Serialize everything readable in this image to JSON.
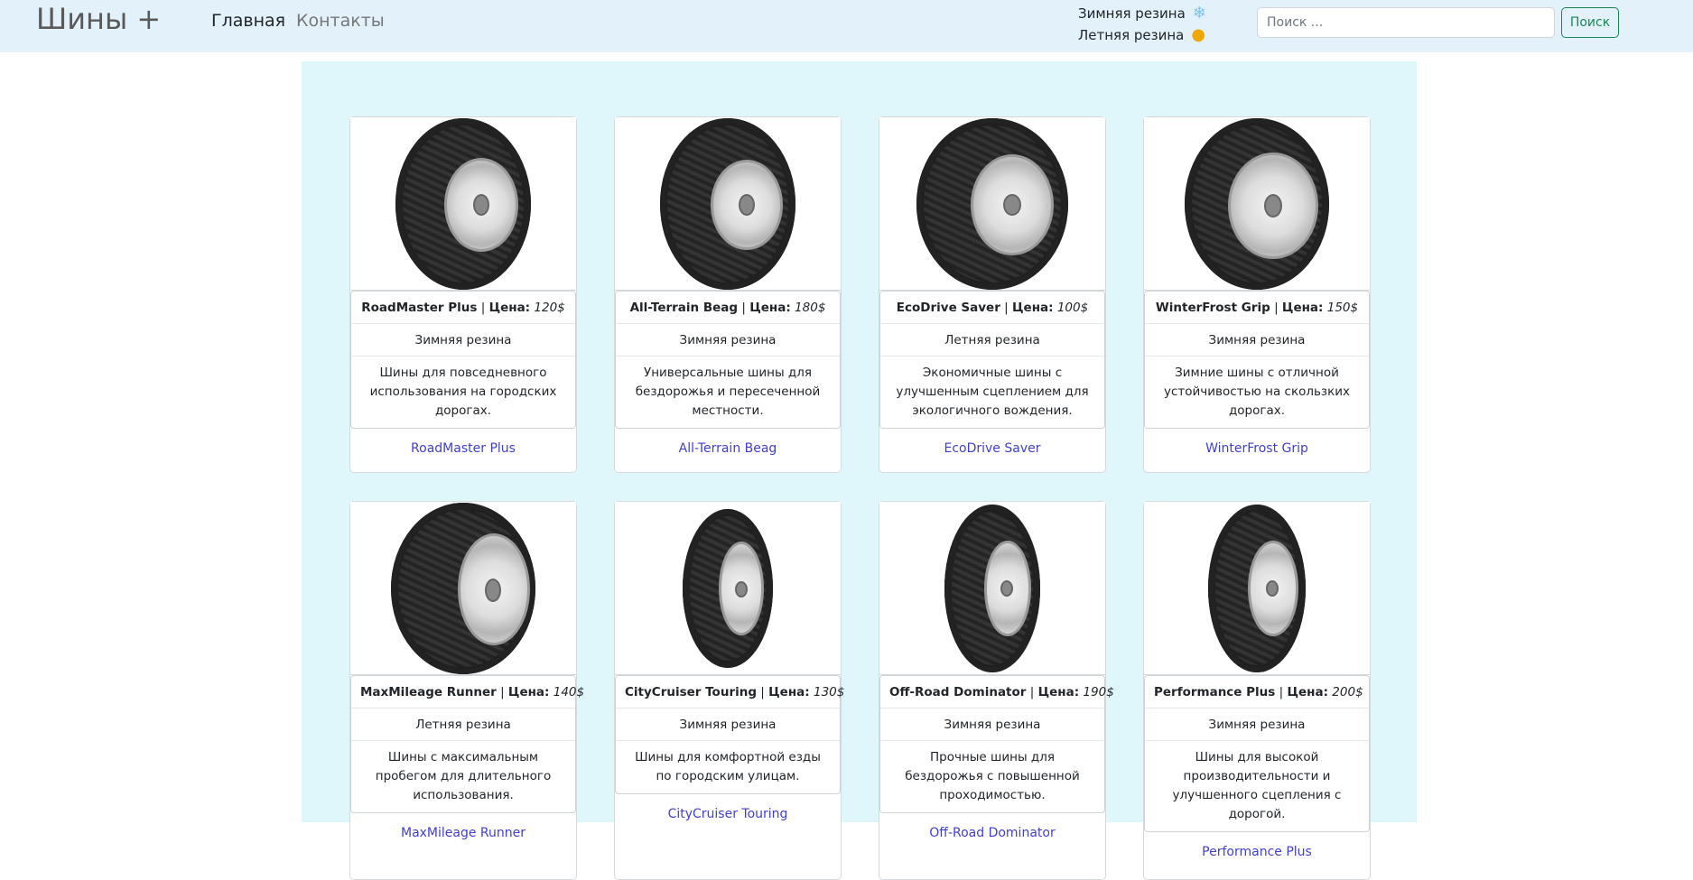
{
  "navbar": {
    "brand": "Шины +",
    "links": [
      {
        "label": "Главная"
      },
      {
        "label": "Контакты"
      }
    ],
    "seasons": [
      {
        "label": "Зимняя резина",
        "icon": "snowflake-icon"
      },
      {
        "label": "Летняя резина",
        "icon": "sun-icon"
      }
    ],
    "search": {
      "placeholder": "Поиск ...",
      "value": "",
      "button_label": "Поиск"
    }
  },
  "products": [
    {
      "name": "RoadMaster Plus",
      "price_label": "Цена:",
      "price": "120$",
      "type": "Зимняя резина",
      "description": "Шины для повседневного использования на городских дорогах.",
      "link": "RoadMaster Plus"
    },
    {
      "name": "All-Terrain Beag",
      "price_label": "Цена:",
      "price": "180$",
      "type": "Зимняя резина",
      "description": "Универсальные шины для бездорожья и пересеченной местности.",
      "link": "All-Terrain Beag"
    },
    {
      "name": "EcoDrive Saver",
      "price_label": "Цена:",
      "price": "100$",
      "type": "Летняя резина",
      "description": "Экономичные шины с улучшенным сцеплением для экологичного вождения.",
      "link": "EcoDrive Saver"
    },
    {
      "name": "WinterFrost Grip",
      "price_label": "Цена:",
      "price": "150$",
      "type": "Зимняя резина",
      "description": "Зимние шины с отличной устойчивостью на скользких дорогах.",
      "link": "WinterFrost Grip"
    },
    {
      "name": "MaxMileage Runner",
      "price_label": "Цена:",
      "price": "140$",
      "type": "Летняя резина",
      "description": "Шины с максимальным пробегом для длительного использования.",
      "link": "MaxMileage Runner"
    },
    {
      "name": "CityCruiser Touring",
      "price_label": "Цена:",
      "price": "130$",
      "type": "Зимняя резина",
      "description": "Шины для комфортной езды по городским улицам.",
      "link": "CityCruiser Touring"
    },
    {
      "name": "Off-Road Dominator",
      "price_label": "Цена:",
      "price": "190$",
      "type": "Зимняя резина",
      "description": "Прочные шины для бездорожья с повышенной проходимостью.",
      "link": "Off-Road Dominator"
    },
    {
      "name": "Performance Plus",
      "price_label": "Цена:",
      "price": "200$",
      "type": "Зимняя резина",
      "description": "Шины для высокой производительности и улучшенного сцепления с дорогой.",
      "link": "Performance Plus"
    }
  ]
}
